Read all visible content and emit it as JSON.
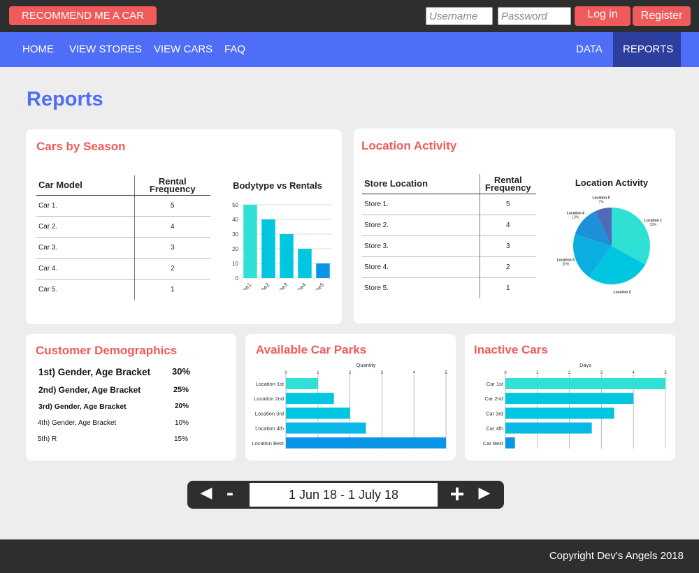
{
  "topbar": {
    "recommend_label": "RECOMMEND ME A CAR",
    "username_placeholder": "Username",
    "password_placeholder": "Password",
    "login_label": "Log in",
    "register_label": "Register"
  },
  "nav": {
    "left": [
      "HOME",
      "VIEW STORES",
      "VIEW CARS",
      "FAQ"
    ],
    "right": [
      "DATA",
      "REPORTS"
    ],
    "active": "REPORTS"
  },
  "page_title": "Reports",
  "season": {
    "title": "Cars by Season",
    "col1": "Car Model",
    "col2_line1": "Rental",
    "col2_line2": "Frequency",
    "rows": [
      {
        "name": "Car 1.",
        "value": "5"
      },
      {
        "name": "Car 2.",
        "value": "4"
      },
      {
        "name": "Car 3.",
        "value": "3"
      },
      {
        "name": "Car 4.",
        "value": "2"
      },
      {
        "name": "Car 5.",
        "value": "1"
      }
    ]
  },
  "location": {
    "title": "Location Activity",
    "col1": "Store Location",
    "col2_line1": "Rental",
    "col2_line2": "Frequency",
    "rows": [
      {
        "name": "Store 1.",
        "value": "5"
      },
      {
        "name": "Store 2.",
        "value": "4"
      },
      {
        "name": "Store 3.",
        "value": "3"
      },
      {
        "name": "Store 4.",
        "value": "2"
      },
      {
        "name": "Store 5.",
        "value": "1"
      }
    ]
  },
  "demographics": {
    "title": "Customer Demographics",
    "rows": [
      {
        "label": "1st) Gender, Age Bracket",
        "value": "30%"
      },
      {
        "label": "2nd) Gender, Age Bracket",
        "value": "25%"
      },
      {
        "label": "3rd) Gender, Age Bracket",
        "value": "20%"
      },
      {
        "label": "4th) Gender, Age Bracket",
        "value": "10%"
      },
      {
        "label": "5th) R",
        "value": "15%"
      }
    ]
  },
  "carparks": {
    "title": "Available Car Parks"
  },
  "inactive": {
    "title": "Inactive Cars"
  },
  "pager": {
    "prev_icon": "◀",
    "minus_label": "-",
    "range": "1 Jun 18 - 1 July 18",
    "plus_label": "+",
    "next_icon": "▶"
  },
  "footer": "Copyright Dev's Angels 2018",
  "colors": {
    "accent_red": "#f05a5a",
    "nav_blue": "#4f6ef7",
    "nav_active": "#2c3f9e",
    "dark": "#2e2e2e",
    "bar_light": "#2fe0d5",
    "bar_mid": "#00c6e0",
    "bar_dark": "#0a96e6"
  },
  "chart_data": [
    {
      "type": "bar",
      "title": "Bodytype vs Rentals",
      "categories": [
        "Type1",
        "Type2",
        "Type3",
        "Type4",
        "Type5"
      ],
      "values": [
        50,
        40,
        30,
        20,
        10
      ],
      "yticks": [
        "0",
        "10",
        "20",
        "30",
        "40",
        "50"
      ],
      "ylim": [
        0,
        50
      ],
      "grid": true
    },
    {
      "type": "pie",
      "title": "Location Activity",
      "labels": [
        "Location 1",
        "Location 2",
        "Location 3",
        "Location 4",
        "Location 5"
      ],
      "values": [
        33,
        27,
        20,
        13,
        7
      ],
      "value_labels": [
        "33%",
        "27%",
        "20%",
        "13%",
        "7%"
      ]
    },
    {
      "type": "bar",
      "orientation": "horizontal",
      "xlabel": "Quantity",
      "categories": [
        "Location 1st",
        "Location 2nd",
        "Location 3rd",
        "Location 4th",
        "Location Best"
      ],
      "values": [
        1,
        1.5,
        2,
        2.5,
        5
      ],
      "xticks": [
        "0",
        "1",
        "2",
        "3",
        "4",
        "5"
      ],
      "xlim": [
        0,
        5
      ],
      "grid": true
    },
    {
      "type": "bar",
      "orientation": "horizontal",
      "xlabel": "Days",
      "categories": [
        "Car 1st",
        "Car 2nd",
        "Car 3rd",
        "Car 4th",
        "Car Best"
      ],
      "values": [
        5,
        4,
        3.4,
        2.7,
        0.3
      ],
      "xticks": [
        "0",
        "1",
        "2",
        "3",
        "4",
        "5"
      ],
      "xlim": [
        0,
        5
      ],
      "grid": true
    }
  ]
}
